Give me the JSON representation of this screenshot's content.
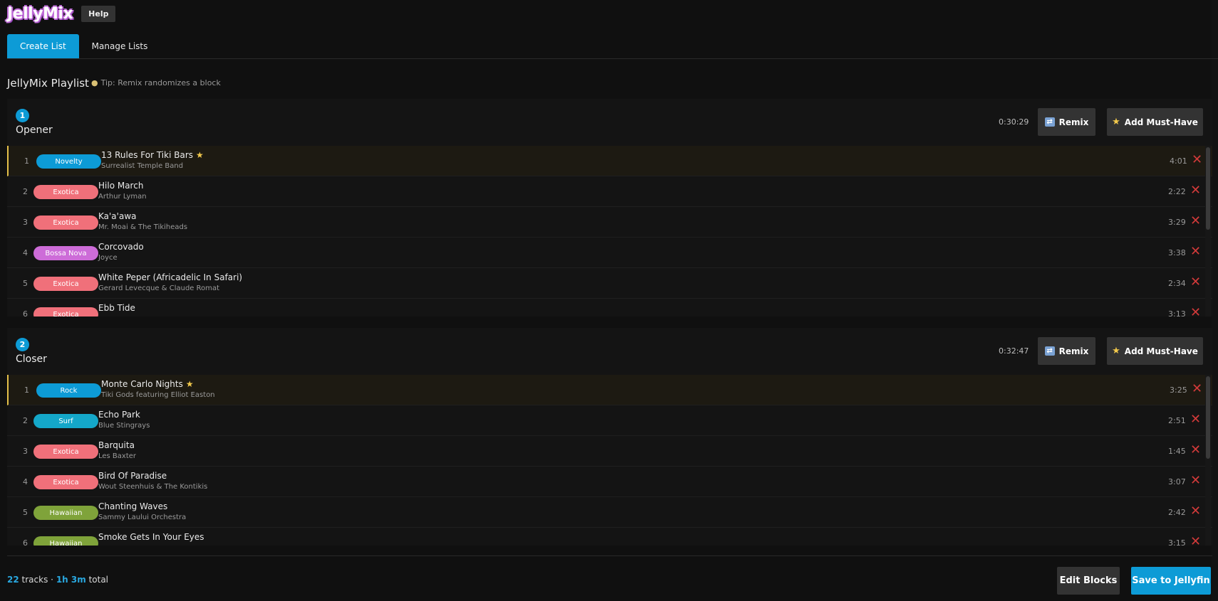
{
  "app": {
    "logo": "JellyMix",
    "help_label": "Help"
  },
  "tabs": [
    {
      "label": "Create List",
      "active": true
    },
    {
      "label": "Manage Lists",
      "active": false
    }
  ],
  "playlist": {
    "title": "JellyMix Playlist",
    "tip": "Tip: Remix randomizes a block"
  },
  "colors": {
    "accent": "#0d9bd6",
    "novelty": "#0d9bd6",
    "exotica": "#f0707a",
    "bossa_nova": "#cd6cd8",
    "rock": "#0d9bd6",
    "surf": "#14a7c9",
    "hawaiian": "#7fa33a",
    "remove": "#d23a3a"
  },
  "blocks": [
    {
      "number": "1",
      "name": "Opener",
      "duration": "0:30:29",
      "remix_label": "Remix",
      "must_have_label": "Add Must-Have",
      "tracks": [
        {
          "idx": "1",
          "genre": "Novelty",
          "genre_color": "#0d9bd6",
          "title": "13 Rules For Tiki Bars",
          "artist": "Surrealist Temple Band",
          "duration": "4:01",
          "must_have": true
        },
        {
          "idx": "2",
          "genre": "Exotica",
          "genre_color": "#f0707a",
          "title": "Hilo March",
          "artist": "Arthur Lyman",
          "duration": "2:22",
          "must_have": false
        },
        {
          "idx": "3",
          "genre": "Exotica",
          "genre_color": "#f0707a",
          "title": "Ka'a'awa",
          "artist": "Mr. Moai & The Tikiheads",
          "duration": "3:29",
          "must_have": false
        },
        {
          "idx": "4",
          "genre": "Bossa Nova",
          "genre_color": "#cd6cd8",
          "title": "Corcovado",
          "artist": "Joyce",
          "duration": "3:38",
          "must_have": false
        },
        {
          "idx": "5",
          "genre": "Exotica",
          "genre_color": "#f0707a",
          "title": "White Peper (Africadelic In Safari)",
          "artist": "Gerard Levecque & Claude Romat",
          "duration": "2:34",
          "must_have": false
        },
        {
          "idx": "6",
          "genre": "Exotica",
          "genre_color": "#f0707a",
          "title": "Ebb Tide",
          "artist": "",
          "duration": "3:13",
          "must_have": false
        }
      ]
    },
    {
      "number": "2",
      "name": "Closer",
      "duration": "0:32:47",
      "remix_label": "Remix",
      "must_have_label": "Add Must-Have",
      "tracks": [
        {
          "idx": "1",
          "genre": "Rock",
          "genre_color": "#0d9bd6",
          "title": "Monte Carlo Nights",
          "artist": "Tiki Gods featuring Elliot Easton",
          "duration": "3:25",
          "must_have": true
        },
        {
          "idx": "2",
          "genre": "Surf",
          "genre_color": "#14a7c9",
          "title": "Echo Park",
          "artist": "Blue Stingrays",
          "duration": "2:51",
          "must_have": false
        },
        {
          "idx": "3",
          "genre": "Exotica",
          "genre_color": "#f0707a",
          "title": "Barquita",
          "artist": "Les Baxter",
          "duration": "1:45",
          "must_have": false
        },
        {
          "idx": "4",
          "genre": "Exotica",
          "genre_color": "#f0707a",
          "title": "Bird Of Paradise",
          "artist": "Wout Steenhuis & The Kontikis",
          "duration": "3:07",
          "must_have": false
        },
        {
          "idx": "5",
          "genre": "Hawaiian",
          "genre_color": "#7fa33a",
          "title": "Chanting Waves",
          "artist": "Sammy Laului Orchestra",
          "duration": "2:42",
          "must_have": false
        },
        {
          "idx": "6",
          "genre": "Hawaiian",
          "genre_color": "#7fa33a",
          "title": "Smoke Gets In Your Eyes",
          "artist": "",
          "duration": "3:15",
          "must_have": false
        }
      ]
    }
  ],
  "footer": {
    "track_count": "22",
    "tracks_word": "tracks",
    "separator": "·",
    "total_time": "1h 3m",
    "total_word": "total",
    "edit_blocks_label": "Edit Blocks",
    "save_label": "Save to Jellyfin"
  }
}
